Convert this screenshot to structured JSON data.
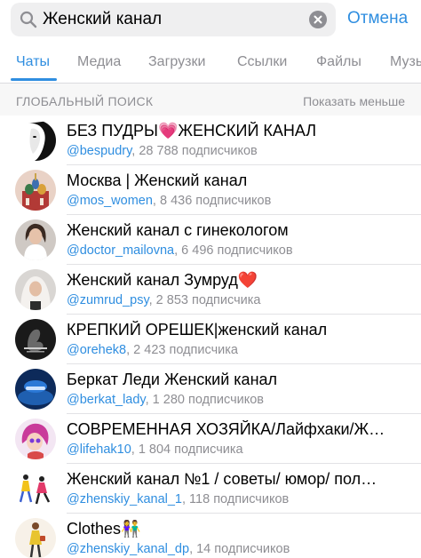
{
  "search": {
    "query": "Женский канал",
    "cancel_label": "Отмена"
  },
  "tabs": [
    {
      "label": "Чаты",
      "active": true
    },
    {
      "label": "Медиа",
      "active": false
    },
    {
      "label": "Загрузки",
      "active": false
    },
    {
      "label": "Ссылки",
      "active": false
    },
    {
      "label": "Файлы",
      "active": false
    },
    {
      "label": "Музы",
      "active": false
    }
  ],
  "section": {
    "title": "ГЛОБАЛЬНЫЙ ПОИСК",
    "action_label": "Показать меньше"
  },
  "results": [
    {
      "name": "БЕЗ ПУДРЫ💗ЖЕНСКИЙ КАНАЛ",
      "handle": "@bespudry",
      "subs": ", 28 788 подписчиков",
      "avatar": "face-bw-icon"
    },
    {
      "name": "Москва | Женский канал",
      "handle": "@mos_women",
      "subs": ", 8 436 подписчиков",
      "avatar": "kremlin-icon"
    },
    {
      "name": "Женский канал с гинекологом",
      "handle": "@doctor_mailovna",
      "subs": ", 6 496 подписчиков",
      "avatar": "doctor-portrait-icon"
    },
    {
      "name": "Женский канал Зумруд❤️",
      "handle": "@zumrud_psy",
      "subs": ", 2 853 подписчика",
      "avatar": "hijab-portrait-icon"
    },
    {
      "name": "КРЕПКИЙ ОРЕШЕК|женский канал",
      "handle": "@orehek8",
      "subs": ", 2 423 подписчика",
      "avatar": "dark-logo-icon"
    },
    {
      "name": "Беркат Леди Женский канал",
      "handle": "@berkat_lady",
      "subs": ", 1 280 подписчиков",
      "avatar": "blue-logo-icon"
    },
    {
      "name": "СОВРЕМЕННАЯ ХОЗЯЙКА/Лайфхаки/Ж…",
      "handle": "@lifehak10",
      "subs": ", 1 804 подписчика",
      "avatar": "illustrated-woman-icon"
    },
    {
      "name": "Женский канал №1 / советы/ юмор/ пол…",
      "handle": "@zhenskiy_kanal_1",
      "subs": ", 118 подписчиков",
      "avatar": "dancing-figures-icon"
    },
    {
      "name": "Clothes👫",
      "handle": "@zhenskiy_kanal_dp",
      "subs": ", 14 подписчиков",
      "avatar": "fashion-woman-icon"
    }
  ],
  "colors": {
    "accent": "#2f8ee0",
    "secondary_text": "#8e8e93",
    "search_bg": "#efeff0",
    "section_bg": "#f7f7f7"
  }
}
